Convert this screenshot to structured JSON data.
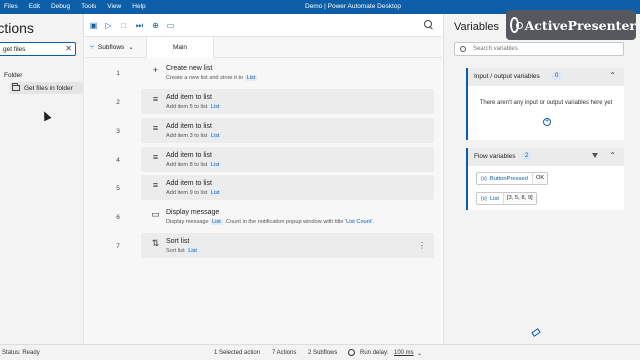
{
  "window": {
    "title": "Demo | Power Automate Desktop",
    "menu": [
      "Files",
      "Edit",
      "Debug",
      "Tools",
      "View",
      "Help"
    ]
  },
  "watermark": {
    "text": "ActivePresenter"
  },
  "actions_pane": {
    "title": "Actions",
    "search_value": "get files",
    "folder_label": "Folder",
    "items": [
      {
        "label": "Get files in folder"
      }
    ]
  },
  "toolbar": {
    "icons": [
      "save-icon",
      "run-icon",
      "stop-icon",
      "next-step-icon",
      "web-recorder-icon",
      "desktop-recorder-icon",
      "search-icon"
    ]
  },
  "tabs": {
    "subflows_label": "Subflows",
    "main_tab": "Main"
  },
  "steps": [
    {
      "num": "1",
      "icon": "plus-icon",
      "title": "Create new list",
      "desc_pre": "Create a new list and store it to ",
      "var": "List"
    },
    {
      "num": "2",
      "icon": "add-item-icon",
      "title": "Add item to list",
      "desc_pre": "Add item 5 to list ",
      "var": "List"
    },
    {
      "num": "3",
      "icon": "add-item-icon",
      "title": "Add item to list",
      "desc_pre": "Add item 3 to list ",
      "var": "List"
    },
    {
      "num": "4",
      "icon": "add-item-icon",
      "title": "Add item to list",
      "desc_pre": "Add item 8 to list ",
      "var": "List"
    },
    {
      "num": "5",
      "icon": "add-item-icon",
      "title": "Add item to list",
      "desc_pre": "Add item 9 to list ",
      "var": "List"
    },
    {
      "num": "6",
      "icon": "message-icon",
      "title": "Display message",
      "desc_pre": "Display message ",
      "var": "List",
      "desc_mid": " .Count in the notification popup window with title ",
      "desc_quote": "'List Count'",
      "desc_end": "."
    },
    {
      "num": "7",
      "icon": "sort-icon",
      "title": "Sort list",
      "desc_pre": "Sort list ",
      "var": "List"
    }
  ],
  "variables_pane": {
    "title": "Variables",
    "search_placeholder": "Search variables",
    "io_section": {
      "title": "Input / output variables",
      "count": "0",
      "empty_message": "There aren't any input or output variables here yet"
    },
    "flow_section": {
      "title": "Flow variables",
      "count": "2",
      "vars": [
        {
          "name": "ButtonPressed",
          "value": "OK"
        },
        {
          "name": "List",
          "value": "[3, 5, 8, 9]"
        }
      ]
    }
  },
  "status_bar": {
    "status": "Status: Ready",
    "selected": "1 Selected action",
    "actions": "7 Actions",
    "subflows": "2 Subflows",
    "run_delay_label": "Run delay:",
    "run_delay_value": "100 ms"
  },
  "colors": {
    "accent": "#0c5ea8",
    "titlebar": "#0c5ea8"
  }
}
